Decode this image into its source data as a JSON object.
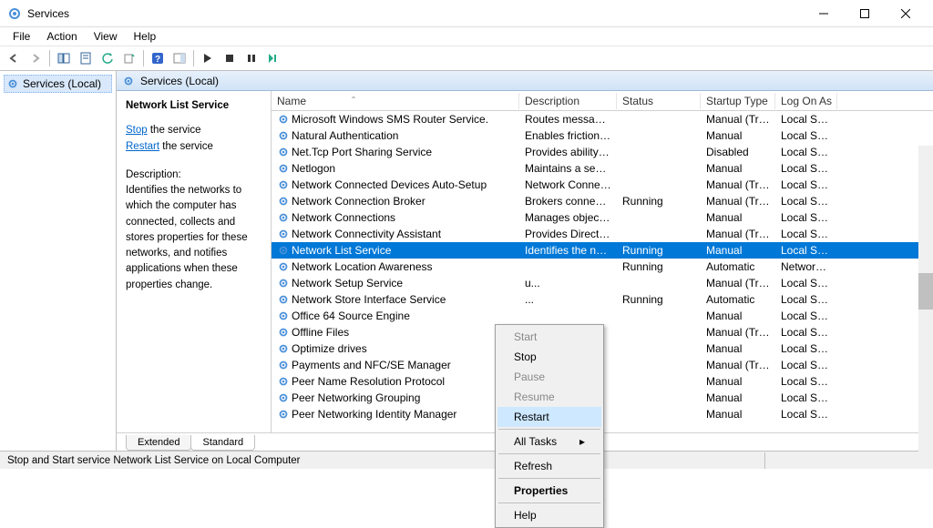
{
  "window": {
    "title": "Services"
  },
  "menubar": [
    "File",
    "Action",
    "View",
    "Help"
  ],
  "nav": {
    "item": "Services (Local)"
  },
  "main_header": "Services (Local)",
  "selected_service": {
    "name": "Network List Service",
    "stop_label": "Stop",
    "stop_suffix": " the service",
    "restart_label": "Restart",
    "restart_suffix": " the service",
    "desc_label": "Description:",
    "description": "Identifies the networks to which the computer has connected, collects and stores properties for these networks, and notifies applications when these properties change."
  },
  "columns": {
    "name": "Name",
    "description": "Description",
    "status": "Status",
    "startup": "Startup Type",
    "logon": "Log On As",
    "sort_indicator": "ˆ"
  },
  "services": [
    {
      "name": "Microsoft Windows SMS Router Service.",
      "desc": "Routes messages...",
      "status": "",
      "startup": "Manual (Tri...",
      "logon": "Local Syst..."
    },
    {
      "name": "Natural Authentication",
      "desc": "Enables friction-fr...",
      "status": "",
      "startup": "Manual",
      "logon": "Local Syst..."
    },
    {
      "name": "Net.Tcp Port Sharing Service",
      "desc": "Provides ability t...",
      "status": "",
      "startup": "Disabled",
      "logon": "Local Serv..."
    },
    {
      "name": "Netlogon",
      "desc": "Maintains a secur...",
      "status": "",
      "startup": "Manual",
      "logon": "Local Syst..."
    },
    {
      "name": "Network Connected Devices Auto-Setup",
      "desc": "Network Connect...",
      "status": "",
      "startup": "Manual (Tri...",
      "logon": "Local Serv..."
    },
    {
      "name": "Network Connection Broker",
      "desc": "Brokers connecti...",
      "status": "Running",
      "startup": "Manual (Tri...",
      "logon": "Local Syst..."
    },
    {
      "name": "Network Connections",
      "desc": "Manages objects...",
      "status": "",
      "startup": "Manual",
      "logon": "Local Syst..."
    },
    {
      "name": "Network Connectivity Assistant",
      "desc": "Provides DirectAc...",
      "status": "",
      "startup": "Manual (Tri...",
      "logon": "Local Syst..."
    },
    {
      "name": "Network List Service",
      "desc": "Identifies the net...",
      "status": "Running",
      "startup": "Manual",
      "logon": "Local Serv...",
      "selected": true
    },
    {
      "name": "Network Location Awareness",
      "desc": "",
      "status": "Running",
      "startup": "Automatic",
      "logon": "Network ..."
    },
    {
      "name": "Network Setup Service",
      "desc": "u...",
      "status": "",
      "startup": "Manual (Tri...",
      "logon": "Local Syst..."
    },
    {
      "name": "Network Store Interface Service",
      "desc": "...",
      "status": "Running",
      "startup": "Automatic",
      "logon": "Local Serv..."
    },
    {
      "name": "Office 64 Source Engine",
      "desc": "",
      "status": "",
      "startup": "Manual",
      "logon": "Local Syst..."
    },
    {
      "name": "Offline Files",
      "desc": "",
      "status": "",
      "startup": "Manual (Tri...",
      "logon": "Local Syst..."
    },
    {
      "name": "Optimize drives",
      "desc": "",
      "status": "",
      "startup": "Manual",
      "logon": "Local Syst..."
    },
    {
      "name": "Payments and NFC/SE Manager",
      "desc": "",
      "status": "",
      "startup": "Manual (Tri...",
      "logon": "Local Serv..."
    },
    {
      "name": "Peer Name Resolution Protocol",
      "desc": "",
      "status": "",
      "startup": "Manual",
      "logon": "Local Serv..."
    },
    {
      "name": "Peer Networking Grouping",
      "desc": "",
      "status": "",
      "startup": "Manual",
      "logon": "Local Serv..."
    },
    {
      "name": "Peer Networking Identity Manager",
      "desc": "",
      "status": "",
      "startup": "Manual",
      "logon": "Local Serv..."
    }
  ],
  "context_menu": [
    {
      "label": "Start",
      "disabled": true
    },
    {
      "label": "Stop"
    },
    {
      "label": "Pause",
      "disabled": true
    },
    {
      "label": "Resume",
      "disabled": true
    },
    {
      "label": "Restart",
      "hover": true
    },
    {
      "sep": true
    },
    {
      "label": "All Tasks",
      "submenu": true
    },
    {
      "sep": true
    },
    {
      "label": "Refresh"
    },
    {
      "sep": true
    },
    {
      "label": "Properties",
      "bold": true
    },
    {
      "sep": true
    },
    {
      "label": "Help"
    }
  ],
  "tabs": {
    "extended": "Extended",
    "standard": "Standard"
  },
  "statusbar": "Stop and Start service Network List Service on Local Computer"
}
